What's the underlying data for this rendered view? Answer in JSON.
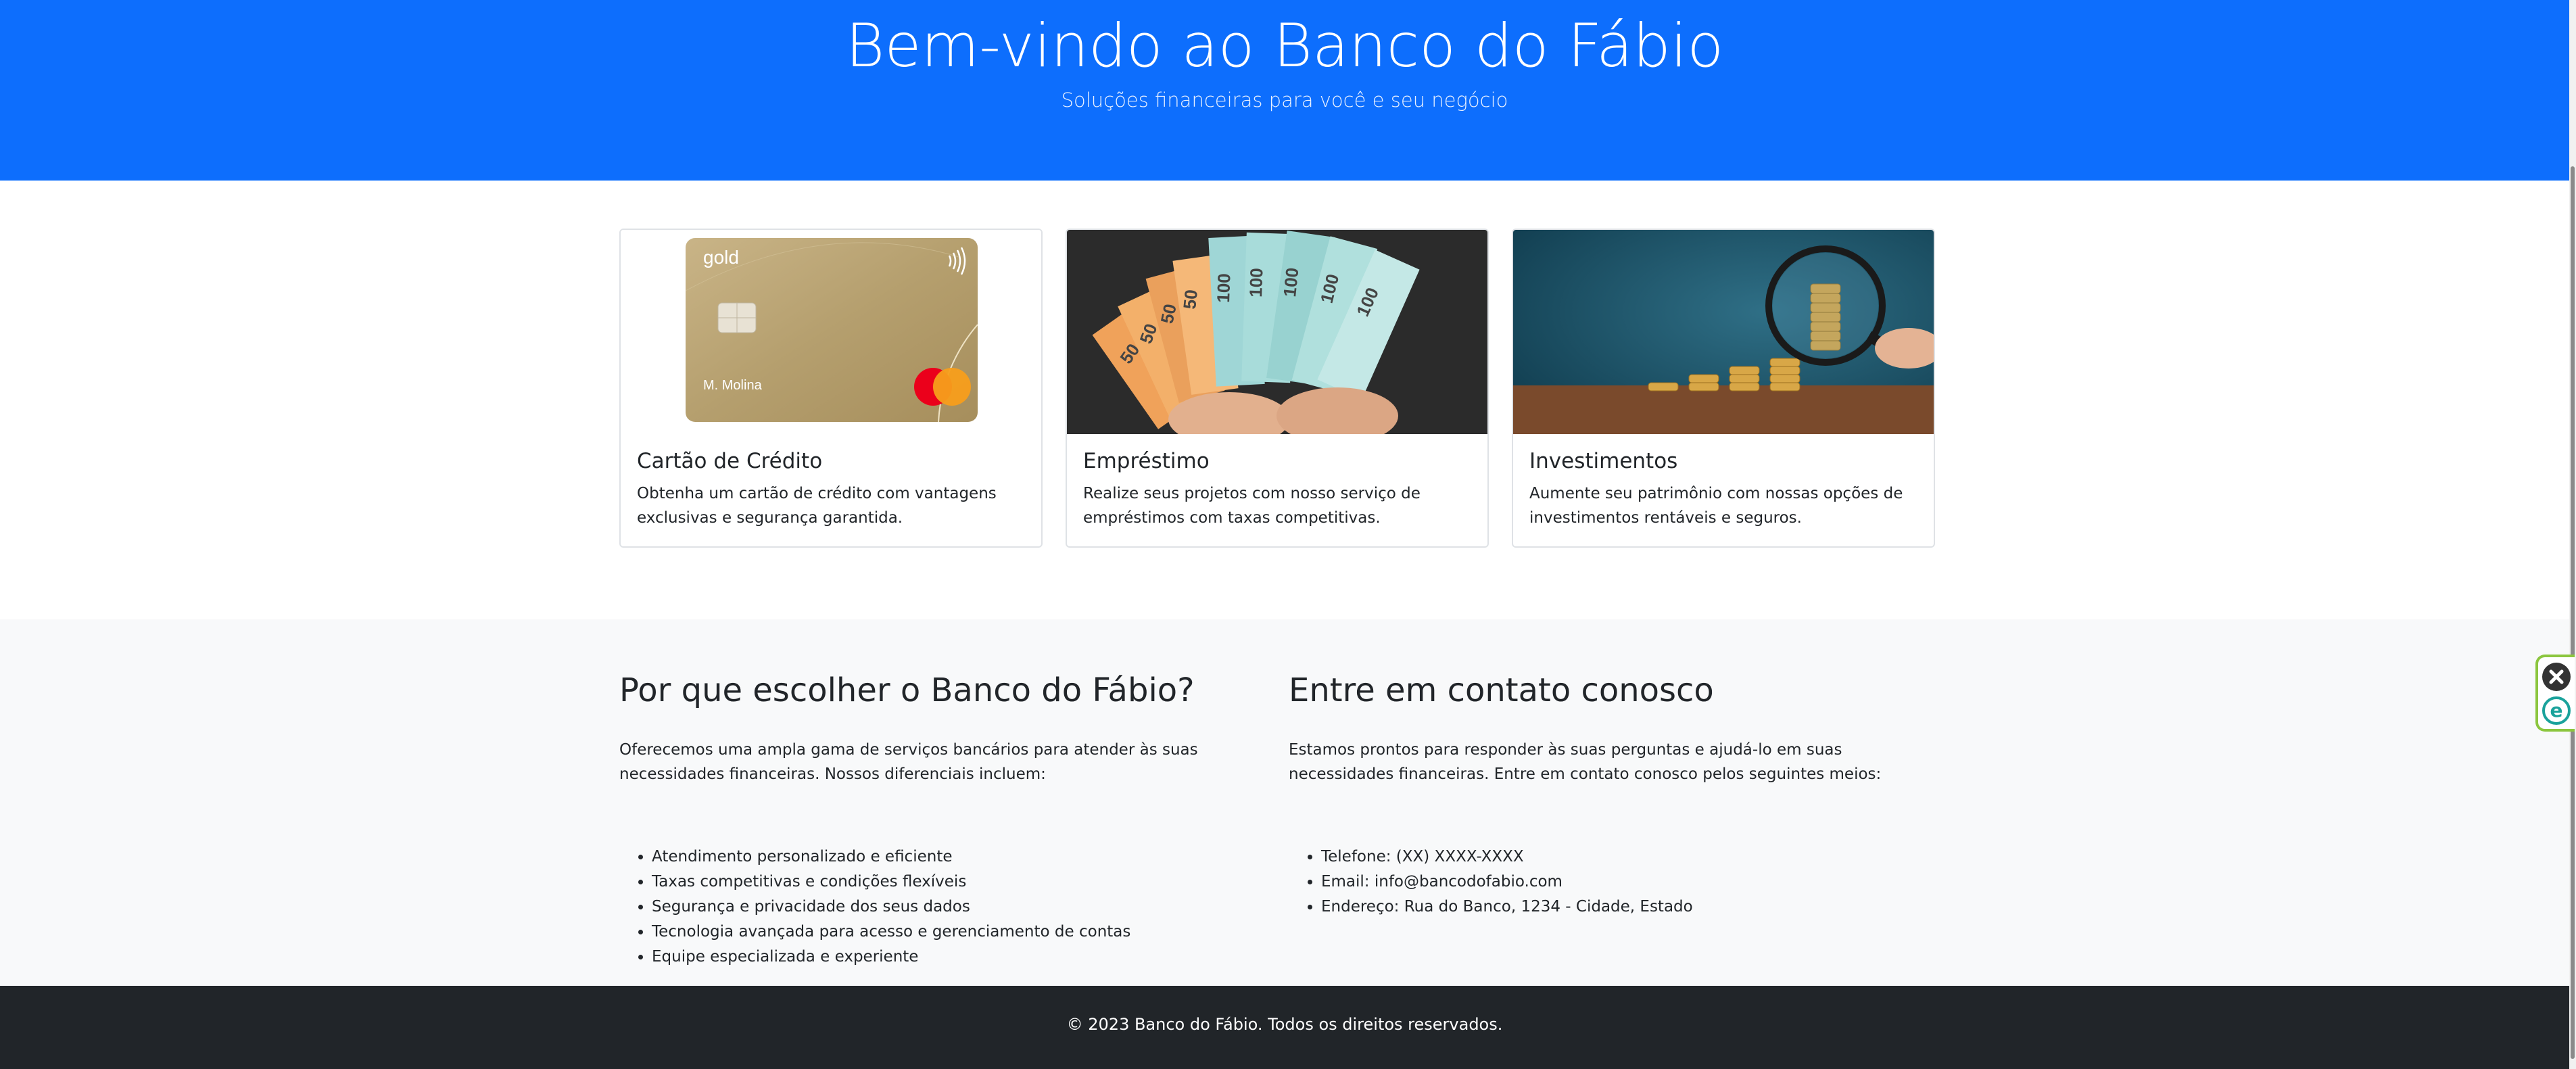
{
  "hero": {
    "title": "Bem-vindo ao Banco do Fábio",
    "subtitle": "Soluções financeiras para você e seu negócio"
  },
  "services": [
    {
      "title": "Cartão de Crédito",
      "text": "Obtenha um cartão de crédito com vantagens exclusivas e segurança garantida.",
      "image": {
        "card_brand_label": "gold",
        "card_holder": "M. Molina",
        "icon": "credit-card-image"
      }
    },
    {
      "title": "Empréstimo",
      "text": "Realize seus projetos com nosso serviço de empréstimos com taxas competitivas.",
      "image": {
        "note_values": [
          "50",
          "50",
          "50",
          "50",
          "100",
          "100",
          "100",
          "100",
          "100"
        ],
        "icon": "banknotes-image"
      }
    },
    {
      "title": "Investimentos",
      "text": "Aumente seu patrimônio com nossas opções de investimentos rentáveis e seguros.",
      "image": {
        "icon": "coins-magnifier-image"
      }
    }
  ],
  "why": {
    "heading": "Por que escolher o Banco do Fábio?",
    "intro": "Oferecemos uma ampla gama de serviços bancários para atender às suas necessidades financeiras. Nossos diferenciais incluem:",
    "items": [
      "Atendimento personalizado e eficiente",
      "Taxas competitivas e condições flexíveis",
      "Segurança e privacidade dos seus dados",
      "Tecnologia avançada para acesso e gerenciamento de contas",
      "Equipe especializada e experiente"
    ]
  },
  "contact": {
    "heading": "Entre em contato conosco",
    "intro": "Estamos prontos para responder às suas perguntas e ajudá-lo em suas necessidades financeiras. Entre em contato conosco pelos seguintes meios:",
    "items": [
      "Telefone: (XX) XXXX-XXXX",
      "Email: info@bancodofabio.com",
      "Endereço: Rua do Banco, 1234 - Cidade, Estado"
    ]
  },
  "footer": {
    "text": "© 2023 Banco do Fábio. Todos os direitos reservados."
  },
  "extension_widget": {
    "letter": "e",
    "icons": [
      "close-icon",
      "extension-e-icon"
    ]
  },
  "colors": {
    "primary": "#0d6efd",
    "light": "#f8f9fa",
    "dark": "#212529",
    "widget_border": "#8cc63f"
  }
}
